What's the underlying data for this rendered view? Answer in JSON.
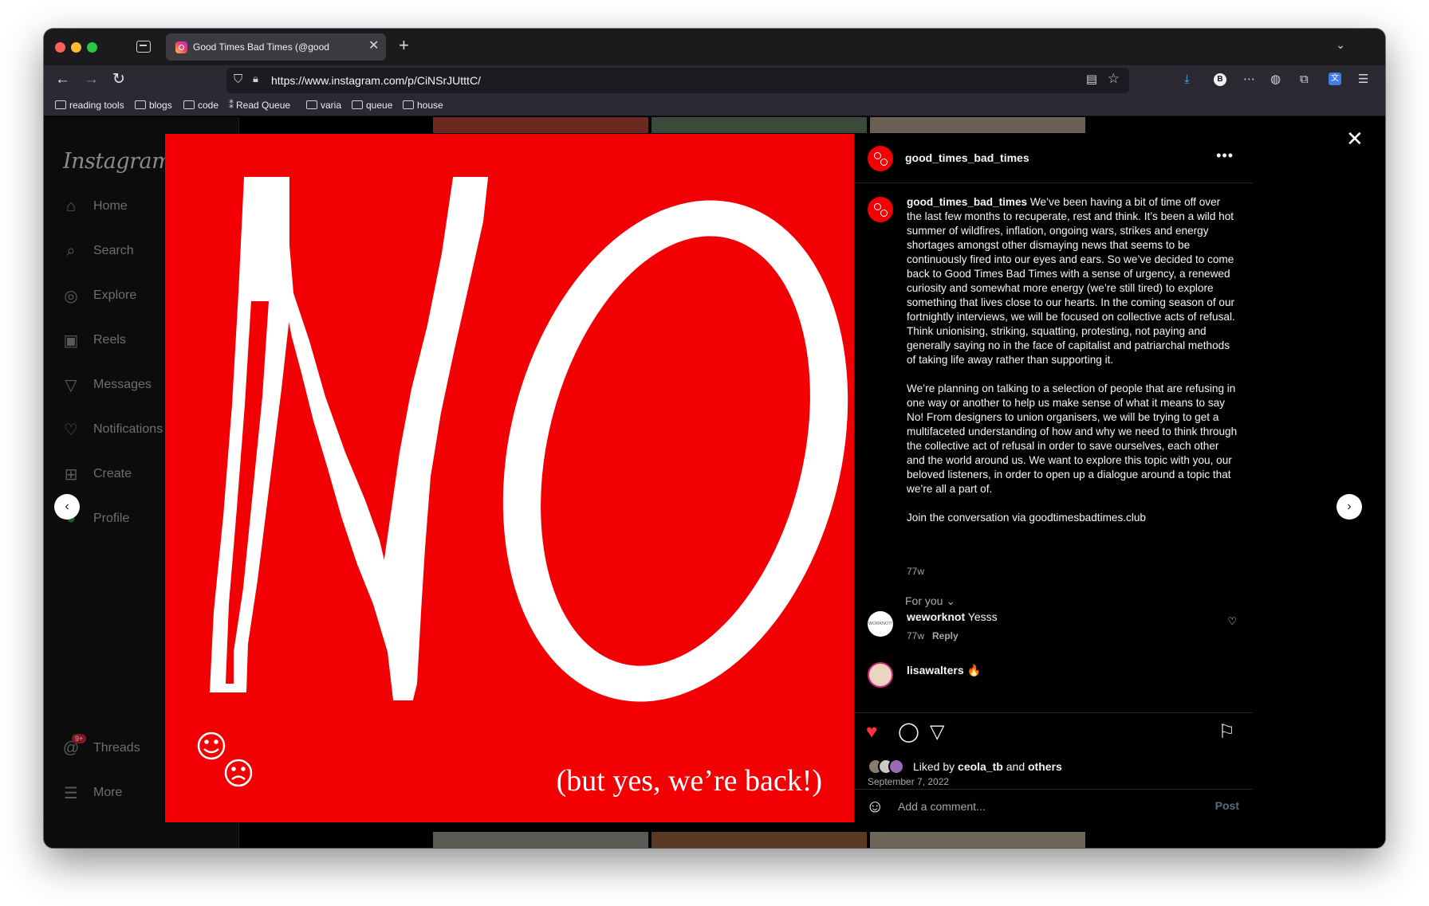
{
  "browser": {
    "tab_title": "Good Times Bad Times (@good",
    "tab_close": "✕",
    "new_tab": "+",
    "url": "https://www.instagram.com/p/CiNSrJUtttC/",
    "extension_b": "B",
    "extension_translate": "文"
  },
  "bookmarks": [
    {
      "label": "reading tools"
    },
    {
      "label": "blogs"
    },
    {
      "label": "code"
    },
    {
      "label": "Read Queue"
    },
    {
      "label": "varia"
    },
    {
      "label": "queue"
    },
    {
      "label": "house"
    }
  ],
  "sidebar": {
    "logo": "Instagram",
    "items": [
      {
        "label": "Home",
        "icon": "home-icon"
      },
      {
        "label": "Search",
        "icon": "search-icon"
      },
      {
        "label": "Explore",
        "icon": "explore-icon"
      },
      {
        "label": "Reels",
        "icon": "reels-icon"
      },
      {
        "label": "Messages",
        "icon": "messages-icon"
      },
      {
        "label": "Notifications",
        "icon": "heart-icon"
      },
      {
        "label": "Create",
        "icon": "create-icon"
      },
      {
        "label": "Profile",
        "icon": "profile-icon"
      },
      {
        "label": "Threads",
        "icon": "threads-icon",
        "badge": "9+"
      },
      {
        "label": "More",
        "icon": "menu-icon"
      }
    ]
  },
  "post": {
    "image_caption": "(but yes, we’re back!)",
    "username": "good_times_bad_times",
    "caption_username": "good_times_bad_times",
    "caption_p1": "We’ve been having a bit of time off over the last few months to recuperate, rest and think. It’s been a wild hot summer of wildfires, inflation, ongoing wars, strikes and energy shortages amongst other dismaying news that seems to be continuously fired into our eyes and ears. So we’ve decided to come back to Good Times Bad Times with a sense of urgency, a renewed curiosity and somewhat more energy (we’re still tired) to explore something that lives close to our hearts. In the coming season of our fortnightly interviews, we will be focused on collective acts of refusal. Think unionising, striking, squatting, protesting, not paying and generally saying no in the face of capitalist and patriarchal methods of taking life away rather than supporting it.",
    "caption_p2": "We’re planning on talking to a selection of people that are refusing in one way or another to help us make sense of what it means to say No! From designers to union organisers, we will be trying to get a multifaceted understanding of how and why we need to think through the collective act of refusal in order to save ourselves, each other and the world around us. We want to explore this topic with you, our beloved listeners, in order to open up a dialogue around a topic that we’re all a part of.",
    "caption_p3": "Join the conversation via goodtimesbadtimes.club",
    "caption_time": "77w",
    "for_you": "For you",
    "comments": [
      {
        "avatar_text": "WORKNOT!",
        "username": "weworknot",
        "text": "Yesss",
        "time": "77w",
        "reply": "Reply"
      },
      {
        "username": "lisawalters",
        "text": "🔥"
      }
    ],
    "liked_by_prefix": "Liked by",
    "liked_by_user": "ceola_tb",
    "liked_by_and": "and",
    "liked_by_others": "others",
    "date": "September 7, 2022",
    "comment_placeholder": "Add a comment...",
    "post_button": "Post"
  },
  "colors": {
    "image_red": "#f20004",
    "like_red": "#ff3040",
    "post_button_disabled": "#5a6a85"
  }
}
